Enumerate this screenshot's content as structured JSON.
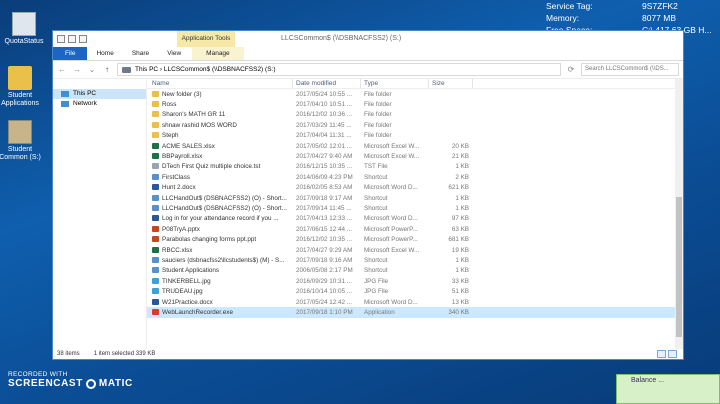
{
  "desktop_info": [
    {
      "key": "Service Tag:",
      "value": "9S7ZFK2"
    },
    {
      "key": "Memory:",
      "value": "8077 MB"
    },
    {
      "key": "Free Space:",
      "value": "C:\\ 417.63 GB H..."
    }
  ],
  "desktop_icons": [
    {
      "label": "QuotaStatus"
    },
    {
      "label": "Student Applications"
    },
    {
      "label": "Student Common (S:)"
    }
  ],
  "ribbon": {
    "context_tab": "Application Tools",
    "window_title": "LLCSCommon$ (\\\\DSBNACFSS2) (S:)",
    "tabs": [
      "File",
      "Home",
      "Share",
      "View",
      "Manage"
    ]
  },
  "address": {
    "path": "This PC  ›  LLCSCommon$ (\\\\DSBNACFSS2) (S:)",
    "search_placeholder": "Search LLCSCommon$ (\\\\DS..."
  },
  "nav_pane": [
    {
      "label": "This PC",
      "selected": true
    },
    {
      "label": "Network",
      "selected": false
    }
  ],
  "columns": [
    "Name",
    "Date modified",
    "Type",
    "Size"
  ],
  "files": [
    {
      "name": "New folder (3)",
      "date": "2017/05/24 10:55 ...",
      "type": "File folder",
      "size": "",
      "icon": "folder"
    },
    {
      "name": "Ross",
      "date": "2017/04/10 10:51 ...",
      "type": "File folder",
      "size": "",
      "icon": "folder"
    },
    {
      "name": "Sharon's MATH GR 11",
      "date": "2016/12/02 10:36 ...",
      "type": "File folder",
      "size": "",
      "icon": "folder"
    },
    {
      "name": "shnaw rashid MOS WORD",
      "date": "2017/03/29 11:45 ...",
      "type": "File folder",
      "size": "",
      "icon": "folder"
    },
    {
      "name": "Steph",
      "date": "2017/04/04 11:31 ...",
      "type": "File folder",
      "size": "",
      "icon": "folder"
    },
    {
      "name": "ACME SALES.xlsx",
      "date": "2017/05/02 12:01 ...",
      "type": "Microsoft Excel W...",
      "size": "20 KB",
      "icon": "excel"
    },
    {
      "name": "BBPayroll.xlsx",
      "date": "2017/04/27 9:40 AM",
      "type": "Microsoft Excel W...",
      "size": "21 KB",
      "icon": "excel"
    },
    {
      "name": "DTech First Quiz multiple choice.tst",
      "date": "2016/12/15 10:35 ...",
      "type": "TST File",
      "size": "1 KB",
      "icon": "file"
    },
    {
      "name": "FirstClass",
      "date": "2014/06/09 4:23 PM",
      "type": "Shortcut",
      "size": "2 KB",
      "icon": "shortcut"
    },
    {
      "name": "Hunt 2.docx",
      "date": "2016/02/05 8:53 AM",
      "type": "Microsoft Word D...",
      "size": "621 KB",
      "icon": "word"
    },
    {
      "name": "LLCHandOut$ (DSBNACFSS2) (O) - Short...",
      "date": "2017/09/18 9:17 AM",
      "type": "Shortcut",
      "size": "1 KB",
      "icon": "shortcut"
    },
    {
      "name": "LLCHandOut$ (DSBNACFSS2) (O) - Short...",
      "date": "2017/09/14 11:45 ...",
      "type": "Shortcut",
      "size": "1 KB",
      "icon": "shortcut"
    },
    {
      "name": "Log in for your attendance record if you ...",
      "date": "2017/04/13 12:33 ...",
      "type": "Microsoft Word D...",
      "size": "97 KB",
      "icon": "word"
    },
    {
      "name": "P08TryA.pptx",
      "date": "2017/06/15 12:44 ...",
      "type": "Microsoft PowerP...",
      "size": "63 KB",
      "icon": "ppt"
    },
    {
      "name": "Parabolas changing forms ppt.ppt",
      "date": "2016/12/02 10:35 ...",
      "type": "Microsoft PowerP...",
      "size": "681 KB",
      "icon": "ppt"
    },
    {
      "name": "RBCC.xlsx",
      "date": "2017/04/27 9:29 AM",
      "type": "Microsoft Excel W...",
      "size": "19 KB",
      "icon": "excel"
    },
    {
      "name": "sauciers (dsbnacfss2\\llcstudents$) (M) - S...",
      "date": "2017/09/18 9:16 AM",
      "type": "Shortcut",
      "size": "1 KB",
      "icon": "shortcut"
    },
    {
      "name": "Student Applications",
      "date": "2006/05/08 2:17 PM",
      "type": "Shortcut",
      "size": "1 KB",
      "icon": "shortcut"
    },
    {
      "name": "TINKERBELL.jpg",
      "date": "2016/09/29 10:31 ...",
      "type": "JPG File",
      "size": "33 KB",
      "icon": "image"
    },
    {
      "name": "TRUDEAU.jpg",
      "date": "2016/10/14 10:05 ...",
      "type": "JPG File",
      "size": "51 KB",
      "icon": "image"
    },
    {
      "name": "W21Practice.docx",
      "date": "2017/05/24 12:42 ...",
      "type": "Microsoft Word D...",
      "size": "13 KB",
      "icon": "word"
    },
    {
      "name": "WebLaunchRecorder.exe",
      "date": "2017/09/18 1:10 PM",
      "type": "Application",
      "size": "340 KB",
      "icon": "app",
      "selected": true
    }
  ],
  "status": {
    "count": "38 items",
    "selection": "1 item selected  339 KB"
  },
  "recorder": {
    "small": "RECORDED WITH",
    "big_a": "SCREENCAST",
    "big_b": "MATIC"
  },
  "taskbar_popup": "Balance ...",
  "colors": {
    "folder": "#e8c04a",
    "excel": "#1e7145",
    "word": "#2b5797",
    "ppt": "#c8461e",
    "file": "#9aa5b1",
    "shortcut": "#5b8fc9",
    "image": "#3f9fd6",
    "app": "#d93b2b",
    "selection": "#cce8ff",
    "file_tab": "#1a66c2"
  }
}
